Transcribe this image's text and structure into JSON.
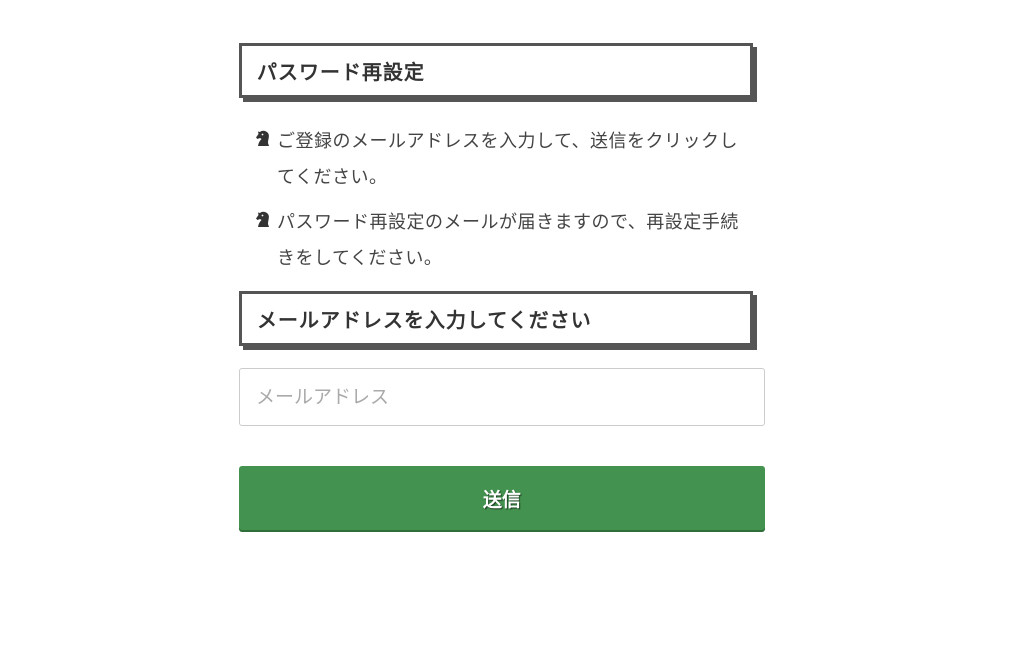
{
  "reset_section": {
    "title": "パスワード再設定"
  },
  "notes": [
    {
      "icon": "chess-knight-icon",
      "text": "ご登録のメールアドレスを入力して、送信をクリックしてください。"
    },
    {
      "icon": "chess-knight-icon",
      "text": "パスワード再設定のメールが届きますので、再設定手続きをしてください。"
    }
  ],
  "email_section": {
    "title": "メールアドレスを入力してください",
    "input_placeholder": "メールアドレス",
    "input_value": ""
  },
  "submit": {
    "label": "送信",
    "color": "#43924f"
  }
}
